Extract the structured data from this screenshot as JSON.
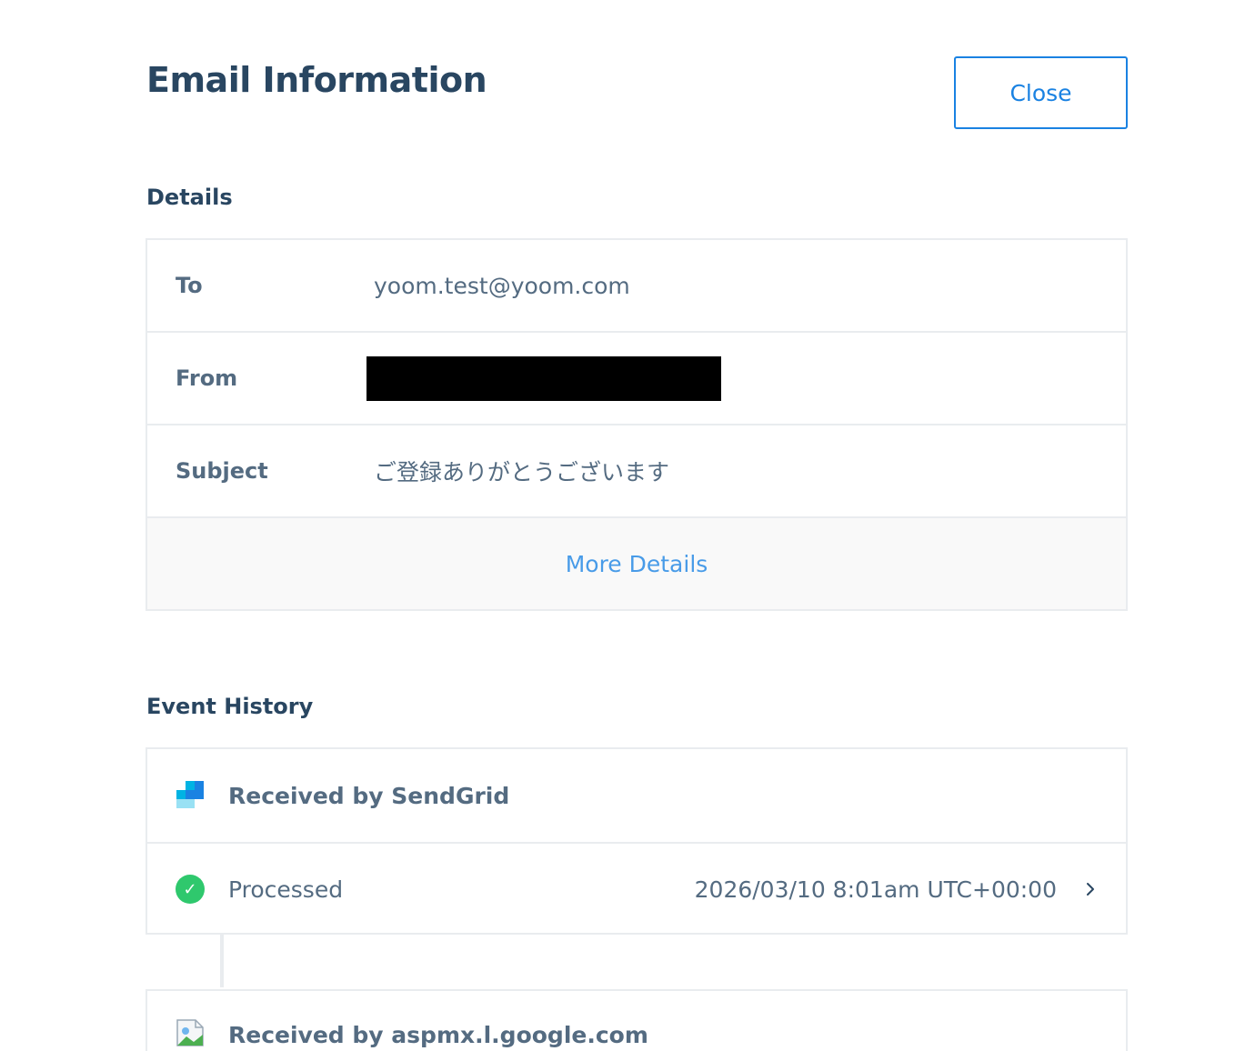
{
  "header": {
    "title": "Email Information",
    "close_label": "Close"
  },
  "details": {
    "section_title": "Details",
    "rows": [
      {
        "label": "To",
        "value": "yoom.test@yoom.com"
      },
      {
        "label": "From",
        "value": ""
      },
      {
        "label": "Subject",
        "value": "ご登録ありがとうございます"
      }
    ],
    "more_details_label": "More Details"
  },
  "events": {
    "section_title": "Event History",
    "groups": [
      {
        "heading": "Received by SendGrid",
        "icon": "sendgrid-logo-icon",
        "items": [
          {
            "status": "Processed",
            "time": "2026/03/10 8:01am UTC+00:00",
            "icon": "check-circle-icon"
          }
        ]
      },
      {
        "heading": "Received by aspmx.l.google.com",
        "icon": "broken-image-icon",
        "items": []
      }
    ]
  },
  "colors": {
    "primary": "#1a82e2",
    "text_dark": "#294661",
    "text_muted": "#546b81",
    "border": "#e9ecef",
    "success": "#2fc86d",
    "link": "#489be8"
  }
}
